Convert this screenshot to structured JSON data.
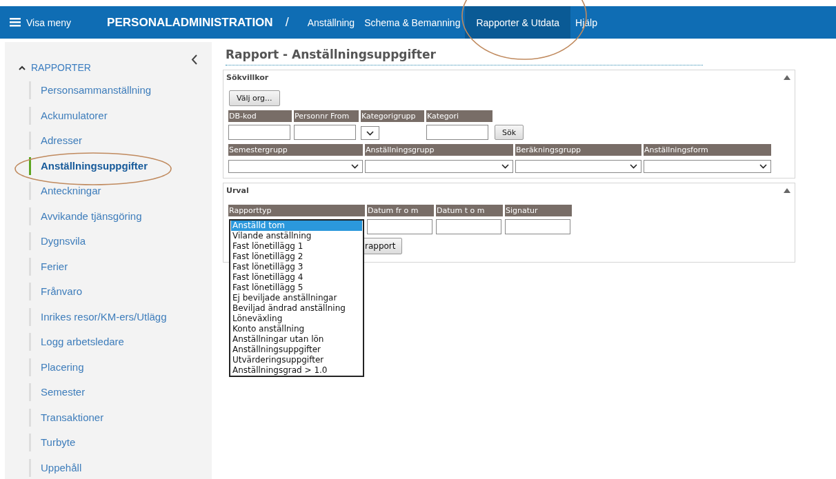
{
  "topbar": {
    "menu_label": "Visa meny",
    "app_title": "PERSONALADMINISTRATION",
    "separator": "/",
    "nav": [
      {
        "label": "Anställning",
        "selected": false
      },
      {
        "label": "Schema & Bemanning",
        "selected": false
      },
      {
        "label": "Rapporter & Utdata",
        "selected": true
      },
      {
        "label": "Hjälp",
        "selected": false
      }
    ]
  },
  "sidebar": {
    "section": {
      "label": "RAPPORTER",
      "expanded": true
    },
    "items": [
      {
        "label": "Personsammanställning",
        "selected": false
      },
      {
        "label": "Ackumulatorer",
        "selected": false
      },
      {
        "label": "Adresser",
        "selected": false
      },
      {
        "label": "Anställningsuppgifter",
        "selected": true
      },
      {
        "label": "Anteckningar",
        "selected": false
      },
      {
        "label": "Avvikande tjänsgöring",
        "selected": false
      },
      {
        "label": "Dygnsvila",
        "selected": false
      },
      {
        "label": "Ferier",
        "selected": false
      },
      {
        "label": "Frånvaro",
        "selected": false
      },
      {
        "label": "Inrikes resor/KM-ers/Utlägg",
        "selected": false
      },
      {
        "label": "Logg arbetsledare",
        "selected": false
      },
      {
        "label": "Placering",
        "selected": false
      },
      {
        "label": "Semester",
        "selected": false
      },
      {
        "label": "Transaktioner",
        "selected": false
      },
      {
        "label": "Turbyte",
        "selected": false
      },
      {
        "label": "Uppehåll",
        "selected": false
      }
    ]
  },
  "main": {
    "title": "Rapport - Anställningsuppgifter",
    "search_panel": {
      "title": "Sökvillkor",
      "org_button": "Välj org...",
      "row1": [
        {
          "label": "DB-kod",
          "kind": "text"
        },
        {
          "label": "Personnr From",
          "kind": "text"
        },
        {
          "label": "Kategorigrupp",
          "kind": "select"
        },
        {
          "label": "Kategori",
          "kind": "text"
        }
      ],
      "search_button": "Sök",
      "row2": [
        {
          "label": "Semestergrupp",
          "kind": "select"
        },
        {
          "label": "Anställningsgrupp",
          "kind": "select"
        },
        {
          "label": "Beräkningsgrupp",
          "kind": "select"
        },
        {
          "label": "Anställningsform",
          "kind": "select"
        }
      ]
    },
    "selection_panel": {
      "title": "Urval",
      "columns": [
        {
          "label": "Rapporttyp",
          "kind": "select"
        },
        {
          "label": "Datum fr o m",
          "kind": "text"
        },
        {
          "label": "Datum t o m",
          "kind": "text"
        },
        {
          "label": "Signatur",
          "kind": "text"
        }
      ],
      "report_button": "rapport",
      "dropdown": [
        {
          "label": "Anställd tom",
          "selected": true
        },
        {
          "label": "Vilande anställning",
          "selected": false
        },
        {
          "label": "Fast lönetillägg 1",
          "selected": false
        },
        {
          "label": "Fast lönetillägg 2",
          "selected": false
        },
        {
          "label": "Fast lönetillägg 3",
          "selected": false
        },
        {
          "label": "Fast lönetillägg 4",
          "selected": false
        },
        {
          "label": "Fast lönetillägg 5",
          "selected": false
        },
        {
          "label": "Ej beviljade anställningar",
          "selected": false
        },
        {
          "label": "Beviljad ändrad anställning",
          "selected": false
        },
        {
          "label": "Löneväxling",
          "selected": false
        },
        {
          "label": "Konto anställning",
          "selected": false
        },
        {
          "label": "Anställningar utan lön",
          "selected": false
        },
        {
          "label": "Anställningsuppgifter",
          "selected": false
        },
        {
          "label": "Utvärderingsuppgifter",
          "selected": false
        },
        {
          "label": "Anställningsgrad > 1.0",
          "selected": false
        }
      ]
    }
  }
}
